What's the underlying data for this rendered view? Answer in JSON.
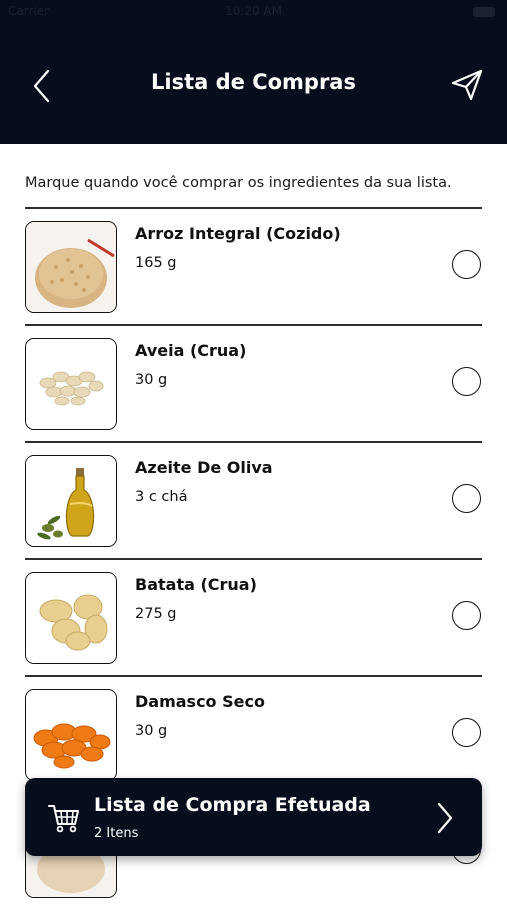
{
  "status_bar": {
    "carrier": "Carrier",
    "time": "10:20 AM"
  },
  "header": {
    "title": "Lista de Compras"
  },
  "instruction": "Marque quando você comprar os ingredientes da sua lista.",
  "items": [
    {
      "name": "Arroz Integral (Cozido)",
      "qty": "165 g",
      "checked": false
    },
    {
      "name": "Aveia (Crua)",
      "qty": "30 g",
      "checked": false
    },
    {
      "name": "Azeite De Oliva",
      "qty": "3 c chá",
      "checked": false
    },
    {
      "name": "Batata (Crua)",
      "qty": "275 g",
      "checked": false
    },
    {
      "name": "Damasco Seco",
      "qty": "30 g",
      "checked": false
    }
  ],
  "banner": {
    "title": "Lista de Compra Efetuada",
    "subtitle": "2 Itens"
  },
  "colors": {
    "header_bg": "#060d1c",
    "banner_bg": "#060d1c",
    "text": "#111111"
  }
}
